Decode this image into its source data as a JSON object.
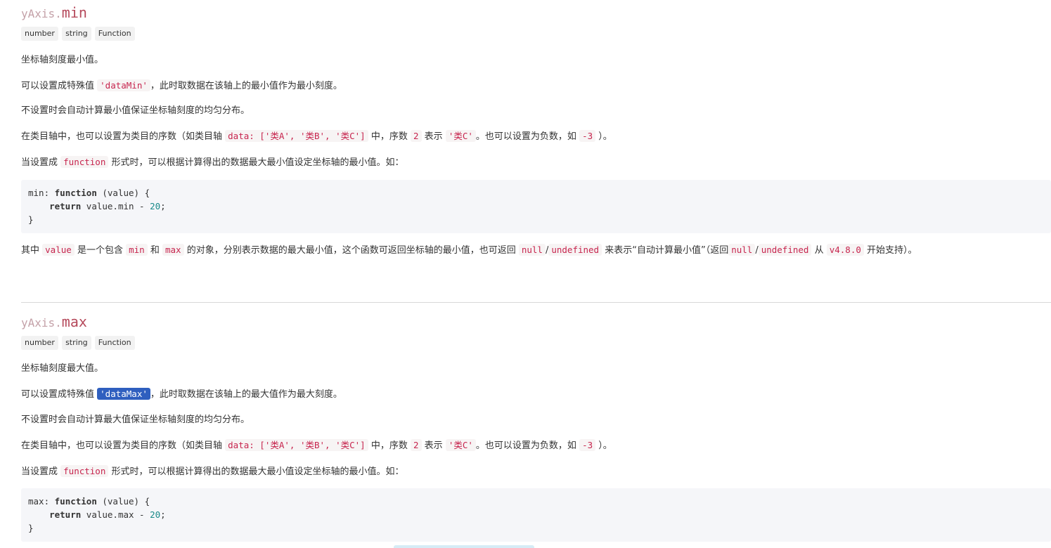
{
  "min": {
    "prefix": "yAxis.",
    "name": "min",
    "types": [
      "number",
      "string",
      "Function"
    ],
    "p1": "坐标轴刻度最小值。",
    "p2_a": "可以设置成特殊值",
    "p2_code": "'dataMin'",
    "p2_b": "，此时取数据在该轴上的最小值作为最小刻度。",
    "p3": "不设置时会自动计算最小值保证坐标轴刻度的均匀分布。",
    "p4_a": "在类目轴中，也可以设置为类目的序数（如类目轴",
    "p4_code1": "data: ['类A', '类B', '类C']",
    "p4_b": "中，序数",
    "p4_code2": "2",
    "p4_c": "表示",
    "p4_code3": "'类C'",
    "p4_d": "。也可以设置为负数，如",
    "p4_code4": "-3",
    "p4_e": "）。",
    "p5_a": "当设置成",
    "p5_code": "function",
    "p5_b": "形式时，可以根据计算得出的数据最大最小值设定坐标轴的最小值。如：",
    "code_l1_key": "min: ",
    "code_l1_kw": "function",
    "code_l1_rest": " (value) {",
    "code_l2_kw": "return",
    "code_l2_rest": " value.min - ",
    "code_l2_num": "20",
    "code_l2_end": ";",
    "code_l3": "}",
    "p6_a": "其中",
    "p6_c1": "value",
    "p6_b": "是一个包含",
    "p6_c2": "min",
    "p6_c": "和",
    "p6_c3": "max",
    "p6_d": "的对象，分别表示数据的最大最小值，这个函数可返回坐标轴的最小值，也可返回",
    "p6_c4": "null",
    "p6_slash": "/",
    "p6_c5": "undefined",
    "p6_e": "来表示“自动计算最小值”（返回",
    "p6_c6": "null",
    "p6_c7": "undefined",
    "p6_f": "从",
    "p6_c8": "v4.8.0",
    "p6_g": "开始支持）。"
  },
  "max": {
    "prefix": "yAxis.",
    "name": "max",
    "types": [
      "number",
      "string",
      "Function"
    ],
    "p1": "坐标轴刻度最大值。",
    "p2_a": "可以设置成特殊值",
    "p2_code": "'dataMax'",
    "p2_b": "，此时取数据在该轴上的最大值作为最大刻度。",
    "p3": "不设置时会自动计算最大值保证坐标轴刻度的均匀分布。",
    "p4_a": "在类目轴中，也可以设置为类目的序数（如类目轴",
    "p4_code1": "data: ['类A', '类B', '类C']",
    "p4_b": "中，序数",
    "p4_code2": "2",
    "p4_c": "表示",
    "p4_code3": "'类C'",
    "p4_d": "。也可以设置为负数，如",
    "p4_code4": "-3",
    "p4_e": "）。",
    "p5_a": "当设置成",
    "p5_code": "function",
    "p5_b": "形式时，可以根据计算得出的数据最大最小值设定坐标轴的最小值。如：",
    "code_l1_key": "max: ",
    "code_l1_kw": "function",
    "code_l1_rest": " (value) {",
    "code_l2_kw": "return",
    "code_l2_rest": " value.max - ",
    "code_l2_num": "20",
    "code_l2_end": ";",
    "code_l3": "}"
  }
}
